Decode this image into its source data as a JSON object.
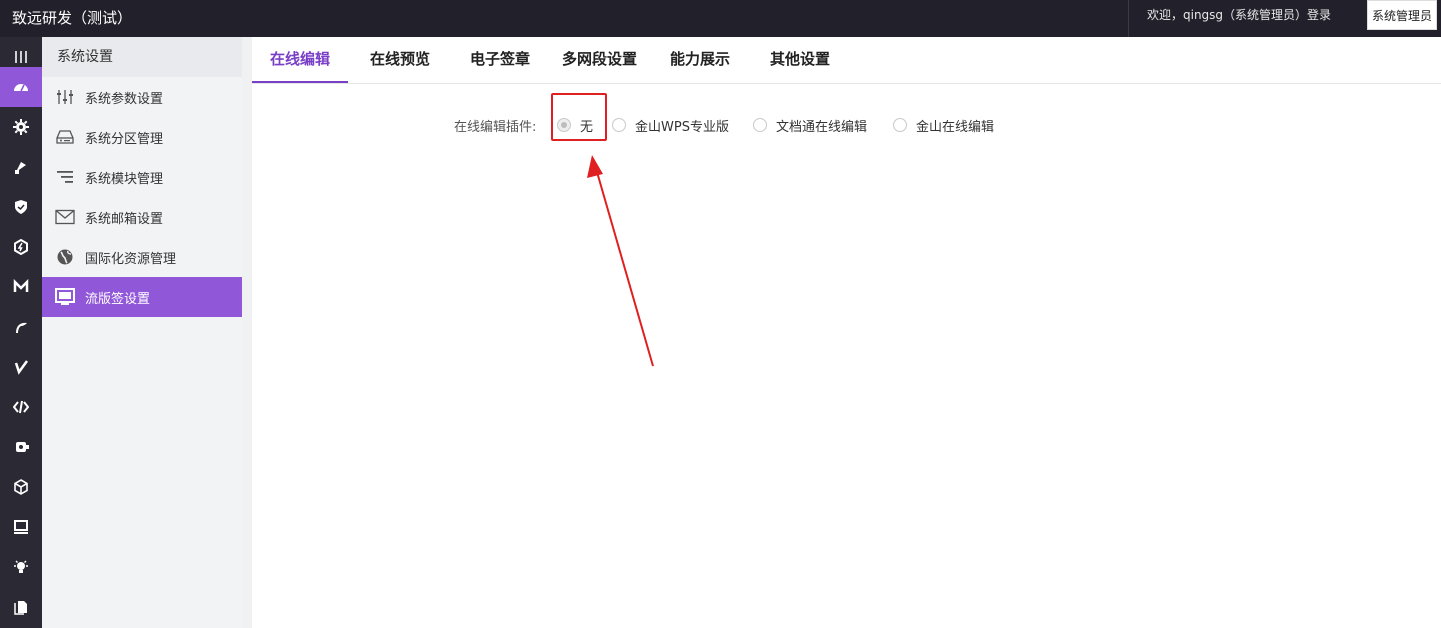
{
  "header": {
    "title": "致远研发（测试）",
    "welcome": "欢迎，qingsg（系统管理员）登录",
    "role_button": "系统管理员"
  },
  "rail": {
    "items": [
      {
        "icon": "menu-icon"
      },
      {
        "icon": "dashboard-icon",
        "active": true
      },
      {
        "icon": "gear-icon"
      },
      {
        "icon": "pin-icon"
      },
      {
        "icon": "shield-icon"
      },
      {
        "icon": "hexagon-icon"
      },
      {
        "icon": "m-icon"
      },
      {
        "icon": "curve-icon"
      },
      {
        "icon": "check-icon"
      },
      {
        "icon": "code-icon"
      },
      {
        "icon": "plugin-icon"
      },
      {
        "icon": "cube-icon"
      },
      {
        "icon": "monitor-icon"
      },
      {
        "icon": "bulb-icon"
      },
      {
        "icon": "copy-icon"
      }
    ]
  },
  "sidebar": {
    "header": "系统设置",
    "items": [
      {
        "label": "系统参数设置",
        "icon": "sliders-icon"
      },
      {
        "label": "系统分区管理",
        "icon": "drive-icon"
      },
      {
        "label": "系统模块管理",
        "icon": "list-icon"
      },
      {
        "label": "系统邮箱设置",
        "icon": "mail-icon"
      },
      {
        "label": "国际化资源管理",
        "icon": "globe-icon"
      },
      {
        "label": "流版签设置",
        "icon": "screen-icon",
        "active": true
      }
    ]
  },
  "tabs": [
    {
      "label": "在线编辑",
      "active": true
    },
    {
      "label": "在线预览"
    },
    {
      "label": "电子签章"
    },
    {
      "label": "多网段设置"
    },
    {
      "label": "能力展示"
    },
    {
      "label": "其他设置"
    }
  ],
  "form": {
    "label": "在线编辑插件:",
    "options": [
      {
        "label": "无",
        "checked": true
      },
      {
        "label": "金山WPS专业版"
      },
      {
        "label": "文档通在线编辑"
      },
      {
        "label": "金山在线编辑"
      }
    ]
  },
  "colors": {
    "accent": "#9157d9",
    "tab_active": "#7a3fc7",
    "topbar": "#22212b",
    "annotation": "#e02020"
  }
}
